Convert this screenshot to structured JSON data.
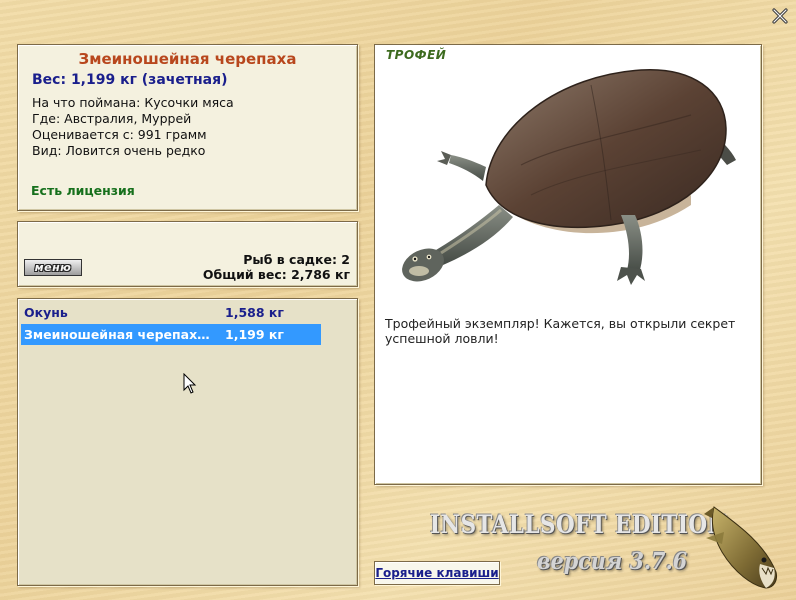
{
  "fish": {
    "name": "Змеиношейная черепаха",
    "weight_text": "Вес: 1,199 кг (зачетная)",
    "bait": "На что поймана: Кусочки мяса",
    "location": "Где: Австралия, Муррей",
    "threshold": "Оценивается с: 991 грамм",
    "rarity": "Вид: Ловится очень редко",
    "license": "Есть лицензия"
  },
  "catch": {
    "menu_label": "меню",
    "fish_count": "Рыб в садке: 2",
    "total_weight": "Общий вес: 2,786 кг"
  },
  "list": {
    "items": [
      {
        "name": "Окунь",
        "weight": "1,588 кг",
        "selected": false
      },
      {
        "name": "Змеиношейная черепах…",
        "weight": "1,199 кг",
        "selected": true
      }
    ]
  },
  "photo": {
    "badge": "ТРОФЕЙ",
    "description": "Трофейный экземпляр! Кажется, вы открыли секрет успешной ловли!"
  },
  "footer": {
    "brand": "INSTALLSOFT EDITION",
    "version": "версия 3.7.6",
    "hotkeys_label": "Горячие клавиши"
  },
  "colors": {
    "title": "#b8471d",
    "weight": "#1a1f8c",
    "license": "#16701c",
    "selection": "#3399ff",
    "background": "#edd39a"
  },
  "icons": [
    "close-icon",
    "turtle-image",
    "pike-logo-icon",
    "mouse-cursor-icon"
  ]
}
